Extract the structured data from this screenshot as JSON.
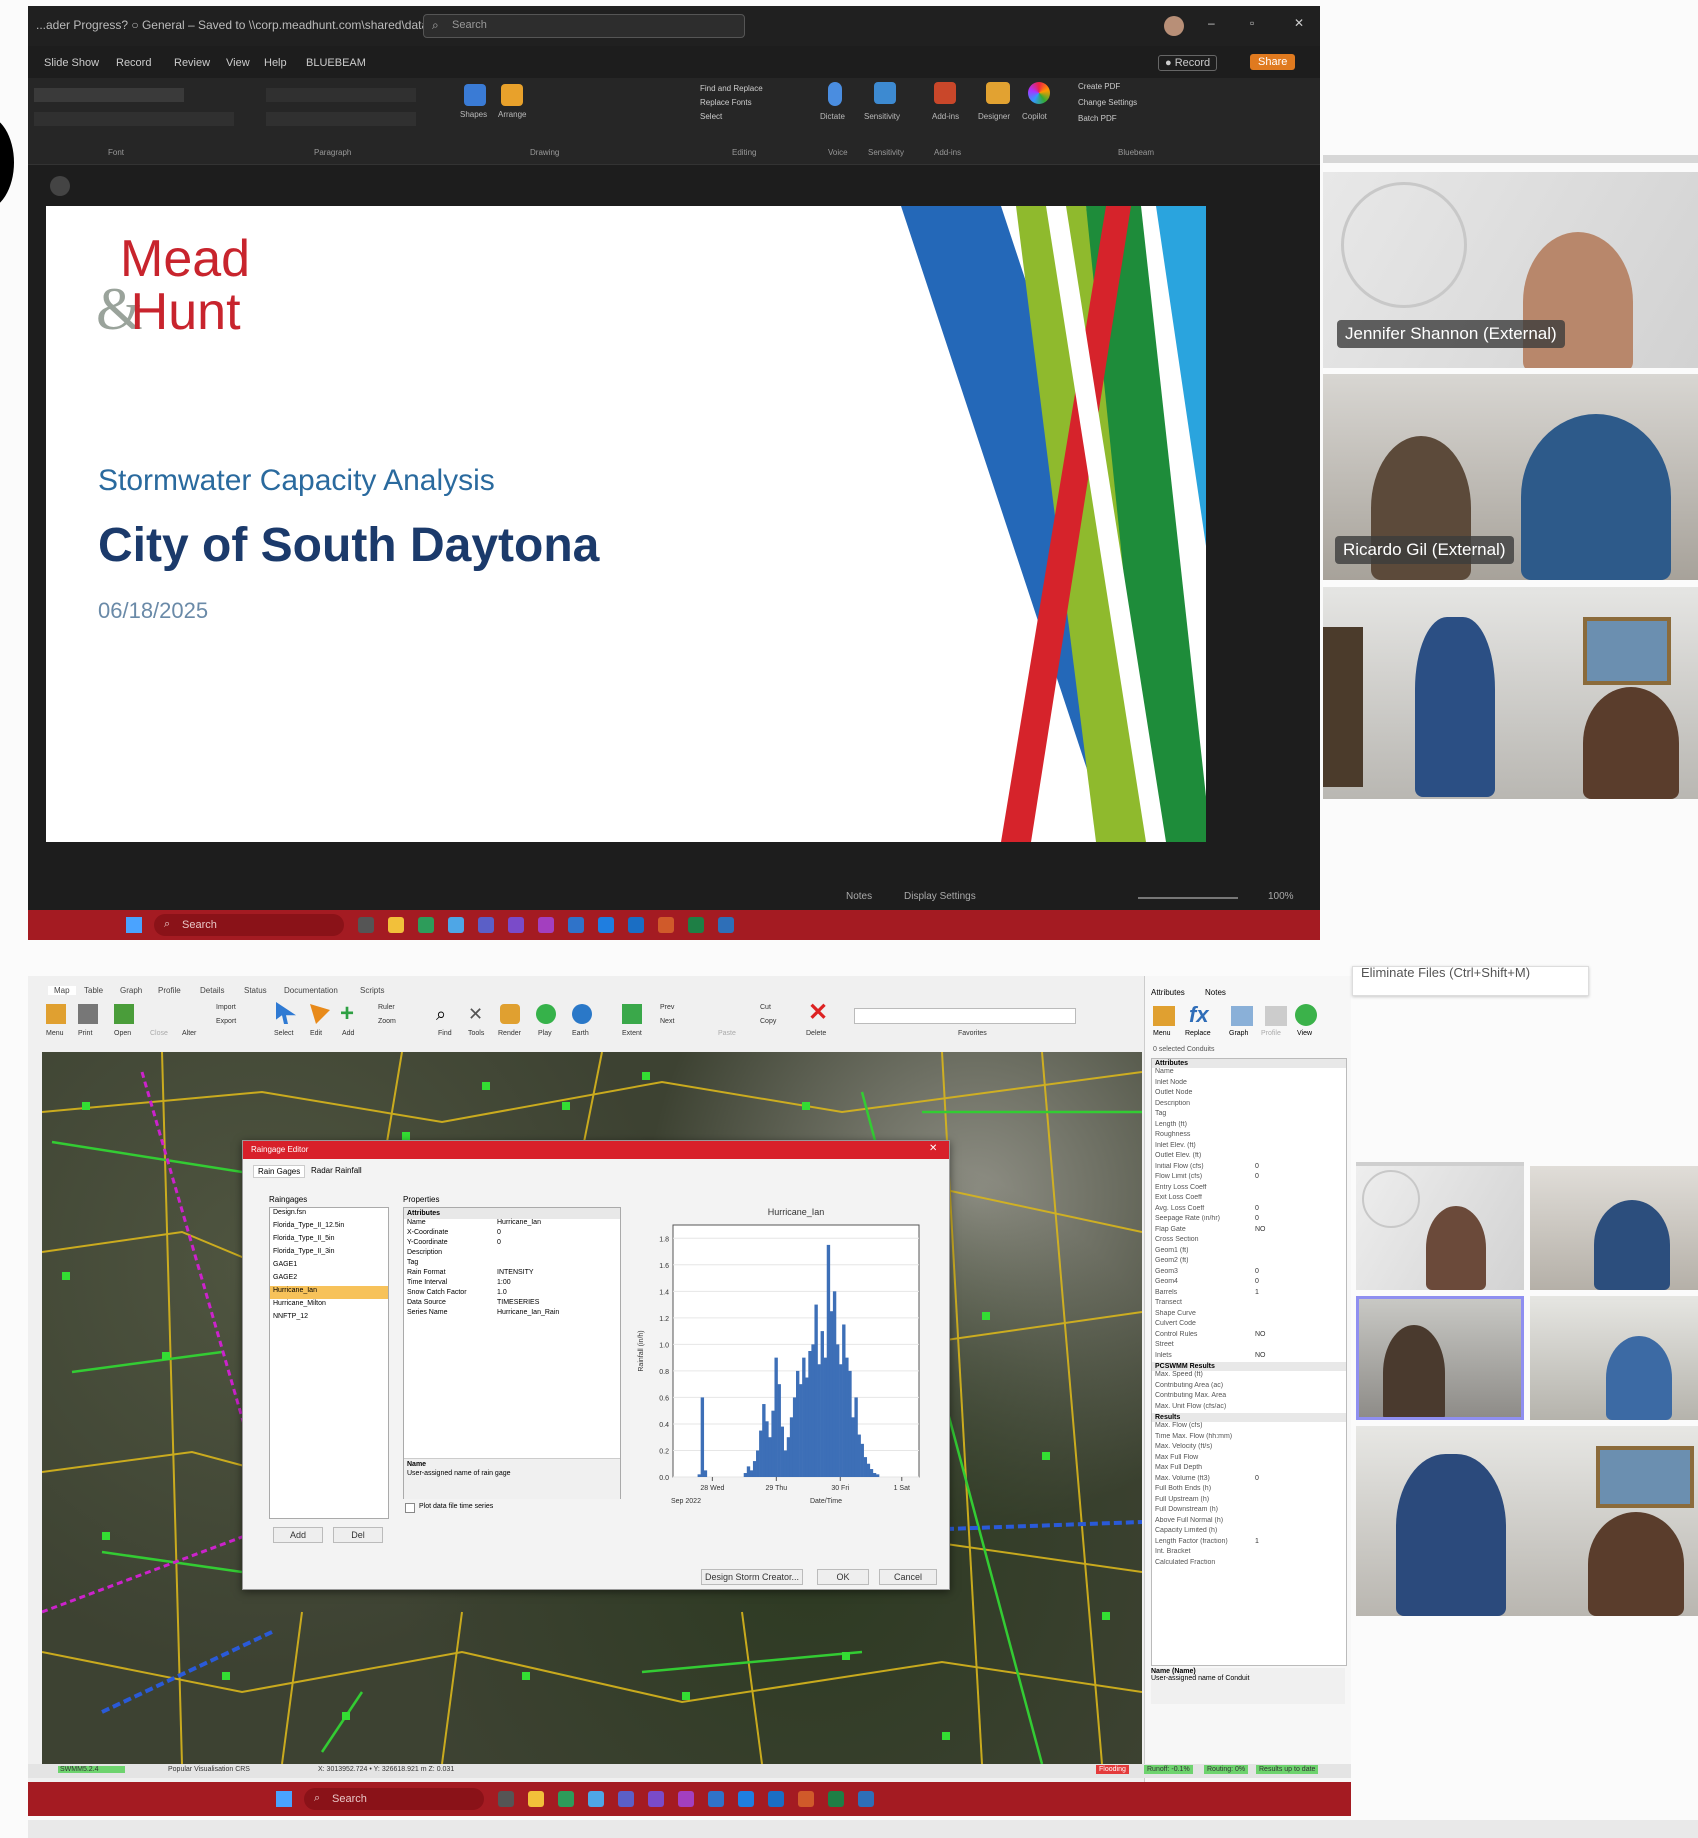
{
  "ppt": {
    "window_title": "...ader Progress? ○ General – Saved to \\\\corp.meadhunt.com\\shared\\data ∨",
    "search_placeholder": "Search",
    "menu": [
      "Slide Show",
      "Record",
      "Review",
      "View",
      "Help",
      "BLUEBEAM"
    ],
    "record_label": "Record",
    "share_label": "Share",
    "ribbon_groups": [
      "Font",
      "Paragraph",
      "Drawing",
      "Editing",
      "Voice",
      "Sensitivity",
      "Add-ins",
      "Bluebeam"
    ],
    "ribbon_buttons": {
      "shapes": "Shapes",
      "arrange": "Arrange",
      "find_replace": "Find and Replace",
      "replace_fonts": "Replace Fonts",
      "select": "Select",
      "dictate": "Dictate",
      "sensitivity": "Sensitivity",
      "addins": "Add-ins",
      "designer": "Designer",
      "copilot": "Copilot",
      "create_pdf": "Create PDF",
      "change_settings": "Change Settings",
      "batch_pdf": "Batch PDF"
    },
    "slide": {
      "logo_line1": "Mead",
      "logo_amp": "&",
      "logo_line2": "Hunt",
      "subtitle": "Stormwater Capacity Analysis",
      "title": "City of South Daytona",
      "date": "06/18/2025"
    },
    "status": {
      "notes": "Notes",
      "display_settings": "Display Settings",
      "zoom": "100%"
    },
    "taskbar_search": "Search"
  },
  "participants_top": [
    {
      "name": "Jennifer Shannon (External)"
    },
    {
      "name": "Ricardo Gil (External)"
    },
    {
      "name": ""
    }
  ],
  "swmm": {
    "tabs": [
      "Map",
      "Table",
      "Graph",
      "Profile",
      "Details",
      "Status",
      "Documentation",
      "Scripts"
    ],
    "toolbar": [
      "Menu",
      "Print",
      "Open",
      "Close",
      "Alter",
      "Import",
      "Export",
      "Select",
      "Edit",
      "Add",
      "Ruler",
      "Zoom",
      "Find",
      "Tools",
      "Render",
      "Play",
      "Earth",
      "Extent",
      "Prev",
      "Next",
      "Paste",
      "Cut",
      "Copy",
      "Delete"
    ],
    "favorites_label": "Favorites",
    "right_tabs": [
      "Attributes",
      "Notes"
    ],
    "right_toolbar": [
      "Menu",
      "Replace",
      "Graph",
      "Profile",
      "View"
    ],
    "right_header": "0 selected Conduits",
    "attributes_title": "Attributes",
    "attributes": [
      [
        "Name",
        ""
      ],
      [
        "Inlet Node",
        ""
      ],
      [
        "Outlet Node",
        ""
      ],
      [
        "Description",
        ""
      ],
      [
        "Tag",
        ""
      ],
      [
        "Length (ft)",
        ""
      ],
      [
        "Roughness",
        ""
      ],
      [
        "Inlet Elev. (ft)",
        ""
      ],
      [
        "Outlet Elev. (ft)",
        ""
      ],
      [
        "Initial Flow (cfs)",
        "0"
      ],
      [
        "Flow Limit (cfs)",
        "0"
      ],
      [
        "Entry Loss Coeff",
        ""
      ],
      [
        "Exit Loss Coeff",
        ""
      ],
      [
        "Avg. Loss Coeff",
        "0"
      ],
      [
        "Seepage Rate (in/hr)",
        "0"
      ],
      [
        "Flap Gate",
        "NO"
      ],
      [
        "Cross Section",
        ""
      ],
      [
        "Geom1 (ft)",
        ""
      ],
      [
        "Geom2 (ft)",
        ""
      ],
      [
        "Geom3",
        "0"
      ],
      [
        "Geom4",
        "0"
      ],
      [
        "Barrels",
        "1"
      ],
      [
        "Transect",
        ""
      ],
      [
        "Shape Curve",
        ""
      ],
      [
        "Culvert Code",
        ""
      ],
      [
        "Control Rules",
        "NO"
      ],
      [
        "Street",
        ""
      ],
      [
        "Inlets",
        "NO"
      ]
    ],
    "results_title": "PCSWMM Results",
    "results": [
      "Max. Speed (ft)",
      "Contributing Area (ac)",
      "Contributing Max. Area",
      "Max. Unit Flow (cfs/ac)"
    ],
    "results2_title": "Results",
    "results2": [
      [
        "Max. Flow (cfs)",
        ""
      ],
      [
        "Time Max. Flow (hh:mm)",
        ""
      ],
      [
        "Max. Velocity (ft/s)",
        ""
      ],
      [
        "Max Full Flow",
        ""
      ],
      [
        "Max Full Depth",
        ""
      ],
      [
        "Max. Volume (ft3)",
        "0"
      ],
      [
        "Full Both Ends (h)",
        ""
      ],
      [
        "Full Upstream (h)",
        ""
      ],
      [
        "Full Downstream (h)",
        ""
      ],
      [
        "Above Full Normal (h)",
        ""
      ],
      [
        "Capacity Limited (h)",
        ""
      ],
      [
        "Length Factor (fraction)",
        "1"
      ],
      [
        "Int. Bracket",
        ""
      ],
      [
        "Calculated Fraction",
        ""
      ]
    ],
    "name_help_title": "Name (Name)",
    "name_help_text": "User-assigned name of Conduit",
    "status_bar": [
      "SWMM5.2.4",
      "Popular Visualisation CRS",
      "X: 3013952.724 • Y: 326618.921 m Z: 0.031"
    ],
    "status_right": [
      "Flooding",
      "Runoff: -0.1%",
      "Routing: 0%",
      "Results up to date"
    ],
    "dialog": {
      "title": "Raingage Editor",
      "tabs": [
        "Rain Gages",
        "Radar Rainfall"
      ],
      "raingages_label": "Raingages",
      "raingages": [
        "Design.fsn",
        "Florida_Type_II_12.5in",
        "Florida_Type_II_5in",
        "Florida_Type_II_3in",
        "GAGE1",
        "GAGE2",
        "Hurricane_Ian",
        "Hurricane_Milton",
        "NNFTP_12"
      ],
      "selected_index": 6,
      "properties_label": "Properties",
      "props_header": "Attributes",
      "props": [
        [
          "Name",
          "Hurricane_Ian"
        ],
        [
          "X-Coordinate",
          "0"
        ],
        [
          "Y-Coordinate",
          "0"
        ],
        [
          "Description",
          ""
        ],
        [
          "Tag",
          ""
        ],
        [
          "Rain Format",
          "INTENSITY"
        ],
        [
          "Time Interval",
          "1:00"
        ],
        [
          "Snow Catch Factor",
          "1.0"
        ],
        [
          "Data Source",
          "TIMESERIES"
        ],
        [
          "Series Name",
          "Hurricane_Ian_Rain"
        ]
      ],
      "help_title": "Name",
      "help_text": "User-assigned name of rain gage",
      "plot_checkbox": "Plot data file time series",
      "add": "Add",
      "del": "Del",
      "design_storm": "Design Storm Creator...",
      "ok": "OK",
      "cancel": "Cancel"
    },
    "taskbar_search": "Search",
    "tooltip": "Eliminate Files (Ctrl+Shift+M)"
  },
  "chart_data": {
    "type": "bar",
    "title": "Hurricane_Ian",
    "xlabel": "Date/Time",
    "ylabel": "Rainfall (in/h)",
    "ylim": [
      0,
      1.9
    ],
    "yticks": [
      0.0,
      0.2,
      0.4,
      0.6,
      0.8,
      1.0,
      1.2,
      1.4,
      1.6,
      1.8
    ],
    "xticks": [
      "28 Wed",
      "29 Thu",
      "30 Fri",
      "1 Sat"
    ],
    "xtick_pos": [
      0.16,
      0.42,
      0.68,
      0.93
    ],
    "x_sublabel": "Sep 2022",
    "values": [
      0,
      0,
      0,
      0,
      0,
      0,
      0,
      0,
      0.02,
      0.6,
      0.05,
      0,
      0,
      0,
      0,
      0,
      0,
      0,
      0,
      0,
      0,
      0,
      0,
      0.03,
      0.08,
      0.05,
      0.12,
      0.2,
      0.35,
      0.55,
      0.42,
      0.3,
      0.5,
      0.9,
      0.7,
      0.38,
      0.2,
      0.3,
      0.45,
      0.6,
      0.8,
      0.7,
      0.9,
      0.75,
      0.95,
      1.0,
      1.3,
      0.85,
      1.1,
      0.9,
      1.75,
      1.25,
      1.4,
      1.0,
      0.85,
      1.15,
      0.9,
      0.8,
      0.45,
      0.6,
      0.32,
      0.25,
      0.15,
      0.1,
      0.06,
      0.03,
      0.02,
      0,
      0,
      0,
      0,
      0,
      0,
      0,
      0,
      0,
      0,
      0,
      0,
      0
    ]
  },
  "colors": {
    "accent_red": "#c8242d",
    "swmm_red": "#d8202a",
    "taskbar": "#a41b22",
    "navy": "#1b3a6b",
    "chart_blue": "#3d6fb7"
  }
}
